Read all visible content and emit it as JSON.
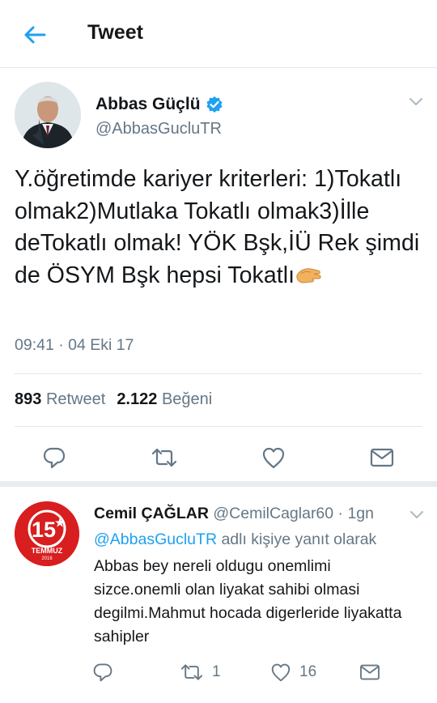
{
  "header": {
    "title": "Tweet"
  },
  "tweet": {
    "author_name": "Abbas Güçlü",
    "author_handle": "@AbbasGucluTR",
    "text": "Y.öğretimde kariyer kriterleri: 1)Tokatlı olmak2)Mutlaka Tokatlı olmak3)İlle deTokatlı olmak! YÖK Bşk,İÜ Rek şimdi de ÖSYM Bşk hepsi Tokatlı",
    "emoji": "clapping-hands-icon",
    "timestamp": "09:41 · 04 Eki 17",
    "retweets_count": "893",
    "retweets_label": "Retweet",
    "likes_count": "2.122",
    "likes_label": "Beğeni"
  },
  "reply": {
    "author_name": "Cemil ÇAĞLAR",
    "author_handle": "@CemilCaglar60",
    "time": "· 1gn",
    "context_mention": "@AbbasGucluTR",
    "context_suffix": "adlı kişiye yanıt olarak",
    "text": "Abbas bey nereli oldugu onemlimi sizce.onemli olan liyakat sahibi olmasi degilmi.Mahmut hocada digerleride liyakatta sahipler",
    "avatar_number": "15",
    "avatar_label": "TEMMUZ",
    "avatar_year": "2016",
    "retweets_count": "1",
    "likes_count": "16"
  },
  "colors": {
    "accent": "#1da1f2",
    "secondary_text": "#657786",
    "divider": "#e1e8ed",
    "primary_text": "#14171a",
    "avatar_red": "#d81e1e"
  }
}
